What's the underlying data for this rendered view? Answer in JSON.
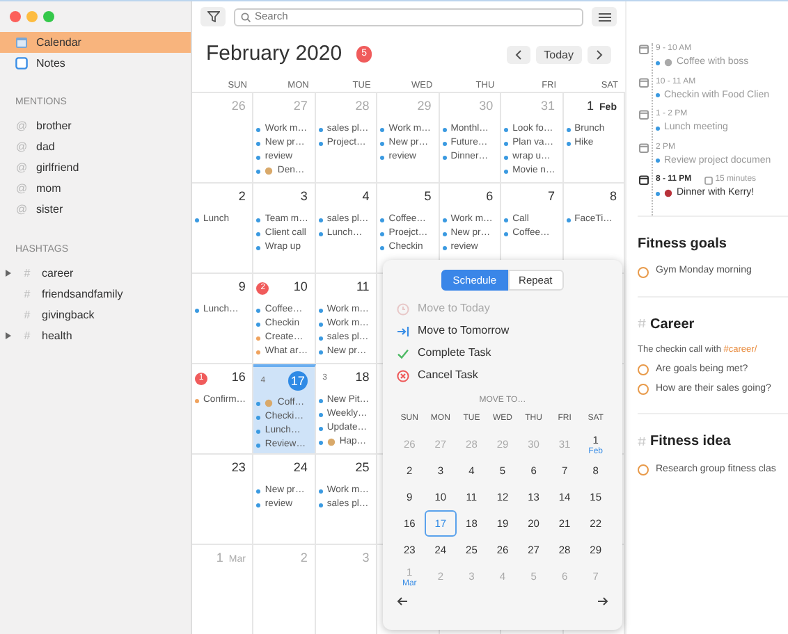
{
  "sidebar": {
    "items": [
      {
        "label": "Calendar",
        "kind": "calendar",
        "selected": true
      },
      {
        "label": "Notes",
        "kind": "notes",
        "selected": false
      }
    ],
    "mentions": {
      "title": "MENTIONS",
      "items": [
        {
          "icon": "@",
          "label": "brother"
        },
        {
          "icon": "@",
          "label": "dad"
        },
        {
          "icon": "@",
          "label": "girlfriend"
        },
        {
          "icon": "@",
          "label": "mom"
        },
        {
          "icon": "@",
          "label": "sister"
        }
      ]
    },
    "hashtags": {
      "title": "HASHTAGS",
      "items": [
        {
          "icon": "#",
          "label": "career",
          "kind": "group"
        },
        {
          "icon": "#",
          "label": "friendsandfamily",
          "kind": "leaf"
        },
        {
          "icon": "#",
          "label": "givingback",
          "kind": "leaf"
        },
        {
          "icon": "#",
          "label": "health",
          "kind": "group"
        }
      ]
    }
  },
  "toolbar": {
    "search": {
      "placeholder": "Search"
    }
  },
  "calendar": {
    "title": "February 2020",
    "badge": "5",
    "today_button": "Today",
    "weekdays": [
      "SUN",
      "MON",
      "TUE",
      "WED",
      "THU",
      "FRI",
      "SAT"
    ],
    "weeks": [
      [
        {
          "day": "26",
          "muted": true
        },
        {
          "day": "27",
          "muted": true,
          "items": [
            {
              "text": "Work m…",
              "color": "#3b9ae1"
            },
            {
              "text": "New pr…",
              "color": "#3b9ae1"
            },
            {
              "text": "review",
              "color": "#3b9ae1"
            },
            {
              "text": "Den…",
              "color": "#3b9ae1",
              "icon": true
            }
          ]
        },
        {
          "day": "28",
          "muted": true,
          "items": [
            {
              "text": "sales pl…",
              "color": "#3b9ae1"
            },
            {
              "text": "Project…",
              "color": "#3b9ae1"
            }
          ]
        },
        {
          "day": "29",
          "muted": true,
          "items": [
            {
              "text": "Work m…",
              "color": "#3b9ae1"
            },
            {
              "text": "New pr…",
              "color": "#3b9ae1"
            },
            {
              "text": "review",
              "color": "#3b9ae1"
            }
          ]
        },
        {
          "day": "30",
          "muted": true,
          "items": [
            {
              "text": "Monthl…",
              "color": "#3b9ae1"
            },
            {
              "text": "Future…",
              "color": "#3b9ae1"
            },
            {
              "text": "Dinner…",
              "color": "#3b9ae1"
            }
          ]
        },
        {
          "day": "31",
          "muted": true,
          "items": [
            {
              "text": "Look fo…",
              "color": "#3b9ae1"
            },
            {
              "text": "Plan va…",
              "color": "#3b9ae1"
            },
            {
              "text": "wrap u…",
              "color": "#3b9ae1"
            },
            {
              "text": "Movie n…",
              "color": "#3b9ae1"
            }
          ]
        },
        {
          "day": "1",
          "month": "Feb",
          "muted": false,
          "items": [
            {
              "text": "Brunch",
              "color": "#3b9ae1"
            },
            {
              "text": "Hike",
              "color": "#3b9ae1"
            }
          ]
        }
      ],
      [
        {
          "day": "2",
          "muted": false,
          "items": [
            {
              "text": "Lunch",
              "color": "#3b9ae1"
            }
          ]
        },
        {
          "day": "3",
          "muted": false,
          "items": [
            {
              "text": "Team m…",
              "color": "#3b9ae1"
            },
            {
              "text": "Client call",
              "color": "#3b9ae1"
            },
            {
              "text": "Wrap up",
              "color": "#3b9ae1"
            }
          ]
        },
        {
          "day": "4",
          "muted": false,
          "items": [
            {
              "text": "sales pl…",
              "color": "#3b9ae1"
            },
            {
              "text": "Lunch…",
              "color": "#3b9ae1"
            }
          ]
        },
        {
          "day": "5",
          "muted": false,
          "items": [
            {
              "text": "Coffee…",
              "color": "#3b9ae1"
            },
            {
              "text": "Proejct…",
              "color": "#3b9ae1"
            },
            {
              "text": "Checkin",
              "color": "#3b9ae1"
            }
          ]
        },
        {
          "day": "6",
          "muted": false,
          "items": [
            {
              "text": "Work m…",
              "color": "#3b9ae1"
            },
            {
              "text": "New pr…",
              "color": "#3b9ae1"
            },
            {
              "text": "review",
              "color": "#3b9ae1"
            }
          ]
        },
        {
          "day": "7",
          "muted": false,
          "items": [
            {
              "text": "Call",
              "color": "#3b9ae1"
            },
            {
              "text": "Coffee…",
              "color": "#3b9ae1"
            }
          ]
        },
        {
          "day": "8",
          "muted": false,
          "items": [
            {
              "text": "FaceTi…",
              "color": "#3b9ae1"
            }
          ]
        }
      ],
      [
        {
          "day": "9",
          "muted": false,
          "items": [
            {
              "text": "Lunch…",
              "color": "#3b9ae1"
            }
          ]
        },
        {
          "day": "10",
          "muted": false,
          "badge": "2",
          "badge_alert": true,
          "items": [
            {
              "text": "Coffee…",
              "color": "#3b9ae1"
            },
            {
              "text": "Checkin",
              "color": "#3b9ae1"
            },
            {
              "text": "Create…",
              "color": "#f0a35e"
            },
            {
              "text": "What ar…",
              "color": "#f0a35e"
            }
          ]
        },
        {
          "day": "11",
          "muted": false,
          "items": [
            {
              "text": "Work m…",
              "color": "#3b9ae1"
            },
            {
              "text": "Work m…",
              "color": "#3b9ae1"
            },
            {
              "text": "sales pl…",
              "color": "#3b9ae1"
            },
            {
              "text": "New pr…",
              "color": "#3b9ae1"
            }
          ]
        }
      ],
      [
        {
          "day": "16",
          "muted": false,
          "badge": "1",
          "badge_alert": true,
          "items": [
            {
              "text": "Confirm…",
              "color": "#f0a35e"
            }
          ]
        },
        {
          "day": "17",
          "muted": false,
          "today": true,
          "selected": true,
          "badge": "4",
          "badge_alert": false,
          "items": [
            {
              "text": "Coff…",
              "color": "#3b9ae1",
              "icon": true
            },
            {
              "text": "Checki…",
              "color": "#3b9ae1"
            },
            {
              "text": "Lunch…",
              "color": "#3b9ae1"
            },
            {
              "text": "Review…",
              "color": "#3b9ae1"
            }
          ]
        },
        {
          "day": "18",
          "muted": false,
          "badge": "3",
          "badge_alert": false,
          "items": [
            {
              "text": "New Pit…",
              "color": "#3b9ae1"
            },
            {
              "text": "Weekly…",
              "color": "#3b9ae1"
            },
            {
              "text": "Update…",
              "color": "#3b9ae1"
            },
            {
              "text": "Hap…",
              "color": "#3b9ae1",
              "icon": true
            }
          ]
        }
      ],
      [
        {
          "day": "23",
          "muted": false
        },
        {
          "day": "24",
          "muted": false,
          "items": [
            {
              "text": "New pr…",
              "color": "#3b9ae1"
            },
            {
              "text": "review",
              "color": "#3b9ae1"
            }
          ]
        },
        {
          "day": "25",
          "muted": false,
          "items": [
            {
              "text": "Work m…",
              "color": "#3b9ae1"
            },
            {
              "text": "sales pl…",
              "color": "#3b9ae1"
            }
          ]
        }
      ],
      [
        {
          "day": "1",
          "month": "Mar",
          "muted": true
        },
        {
          "day": "2",
          "muted": true
        },
        {
          "day": "3",
          "muted": true
        }
      ]
    ]
  },
  "popover": {
    "tabs": [
      {
        "label": "Schedule",
        "selected": true
      },
      {
        "label": "Repeat",
        "selected": false
      }
    ],
    "actions": [
      {
        "label": "Move to Today",
        "kind": "today",
        "disabled": true
      },
      {
        "label": "Move to Tomorrow",
        "kind": "tomorrow",
        "disabled": false
      },
      {
        "label": "Complete Task",
        "kind": "complete",
        "disabled": false
      },
      {
        "label": "Cancel Task",
        "kind": "cancel",
        "disabled": false
      }
    ],
    "move_to": {
      "title": "MOVE TO…",
      "weekdays": [
        "SUN",
        "MON",
        "TUE",
        "WED",
        "THU",
        "FRI",
        "SAT"
      ],
      "weeks": [
        [
          {
            "day": "26",
            "muted": true,
            "selected": false
          },
          {
            "day": "27",
            "muted": true,
            "selected": false
          },
          {
            "day": "28",
            "muted": true,
            "selected": false
          },
          {
            "day": "29",
            "muted": true,
            "selected": false
          },
          {
            "day": "30",
            "muted": true,
            "selected": false
          },
          {
            "day": "31",
            "muted": true,
            "selected": false
          },
          {
            "day": "1",
            "month": "Feb",
            "muted": false,
            "selected": false
          }
        ],
        [
          {
            "day": "2",
            "muted": false,
            "selected": false
          },
          {
            "day": "3",
            "muted": false,
            "selected": false
          },
          {
            "day": "4",
            "muted": false,
            "selected": false
          },
          {
            "day": "5",
            "muted": false,
            "selected": false
          },
          {
            "day": "6",
            "muted": false,
            "selected": false
          },
          {
            "day": "7",
            "muted": false,
            "selected": false
          },
          {
            "day": "8",
            "muted": false,
            "selected": false
          }
        ],
        [
          {
            "day": "9",
            "muted": false,
            "selected": false
          },
          {
            "day": "10",
            "muted": false,
            "selected": false
          },
          {
            "day": "11",
            "muted": false,
            "selected": false
          },
          {
            "day": "12",
            "muted": false,
            "selected": false
          },
          {
            "day": "13",
            "muted": false,
            "selected": false
          },
          {
            "day": "14",
            "muted": false,
            "selected": false
          },
          {
            "day": "15",
            "muted": false,
            "selected": false
          }
        ],
        [
          {
            "day": "16",
            "muted": false,
            "selected": false
          },
          {
            "day": "17",
            "muted": false,
            "selected": true
          },
          {
            "day": "18",
            "muted": false,
            "selected": false
          },
          {
            "day": "19",
            "muted": false,
            "selected": false
          },
          {
            "day": "20",
            "muted": false,
            "selected": false
          },
          {
            "day": "21",
            "muted": false,
            "selected": false
          },
          {
            "day": "22",
            "muted": false,
            "selected": false
          }
        ],
        [
          {
            "day": "23",
            "muted": false,
            "selected": false
          },
          {
            "day": "24",
            "muted": false,
            "selected": false
          },
          {
            "day": "25",
            "muted": false,
            "selected": false
          },
          {
            "day": "26",
            "muted": false,
            "selected": false
          },
          {
            "day": "27",
            "muted": false,
            "selected": false
          },
          {
            "day": "28",
            "muted": false,
            "selected": false
          },
          {
            "day": "29",
            "muted": false,
            "selected": false
          }
        ],
        [
          {
            "day": "1",
            "month": "Mar",
            "muted": true,
            "selected": false
          },
          {
            "day": "2",
            "muted": true,
            "selected": false
          },
          {
            "day": "3",
            "muted": true,
            "selected": false
          },
          {
            "day": "4",
            "muted": true,
            "selected": false
          },
          {
            "day": "5",
            "muted": true,
            "selected": false
          },
          {
            "day": "6",
            "muted": true,
            "selected": false
          },
          {
            "day": "7",
            "muted": true,
            "selected": false
          }
        ]
      ]
    }
  },
  "agenda": {
    "events": [
      {
        "time": "9 - 10 AM",
        "title": "Coffee with boss",
        "icon": true,
        "past": true
      },
      {
        "time": "10 - 11 AM",
        "title": "Checkin with Food Clien",
        "past": true
      },
      {
        "time": "1 - 2 PM",
        "title": "Lunch meeting",
        "past": true
      },
      {
        "time": "2 PM",
        "title": "Review project documen",
        "past": true
      },
      {
        "time": "8 - 11 PM",
        "title": "Dinner with Kerry!",
        "icon": true,
        "past": false,
        "alert": "15 minutes"
      }
    ],
    "sections": [
      {
        "title": "Fitness goals",
        "hashtag": false,
        "blocks": [
          {
            "kind": "todo",
            "text": "Gym Monday morning"
          }
        ]
      },
      {
        "title": "Career",
        "hashtag": true,
        "blocks": [
          {
            "kind": "text",
            "text": "The checkin call with ",
            "tag": "#career/"
          },
          {
            "kind": "todo",
            "text": "Are goals being met?"
          },
          {
            "kind": "todo",
            "text": "How are their sales going?"
          }
        ]
      },
      {
        "title": "Fitness idea",
        "hashtag": true,
        "blocks": [
          {
            "kind": "todo",
            "text": "Research group fitness clas"
          }
        ]
      }
    ]
  }
}
